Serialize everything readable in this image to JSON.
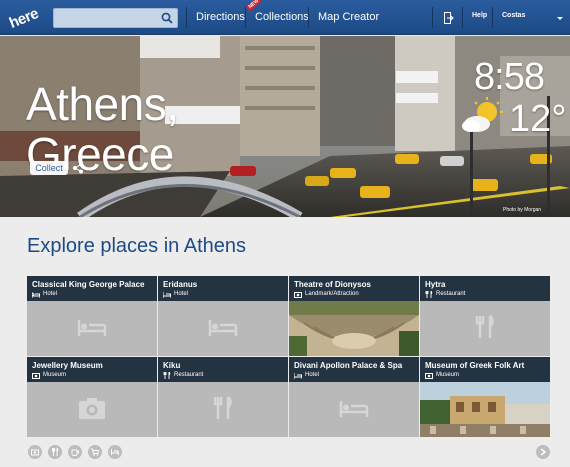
{
  "header": {
    "search_placeholder": "",
    "nav": [
      {
        "label": "Directions"
      },
      {
        "label": "Collections",
        "badge": "NEW"
      },
      {
        "label": "Map Creator"
      }
    ],
    "help_label": "Help",
    "user_label": "Costas"
  },
  "hero": {
    "section_label": "",
    "title_line1": "Athens,",
    "title_line2": "Greece",
    "collect_label": "Collect",
    "time": "8:58",
    "temperature": "12°",
    "credit": "Photo by Morgan"
  },
  "explore": {
    "title": "Explore places in Athens",
    "places": [
      {
        "name": "Classical King George Palace",
        "category": "Hotel",
        "icon": "bed-icon"
      },
      {
        "name": "Eridanus",
        "category": "Hotel",
        "icon": "bed-icon"
      },
      {
        "name": "Theatre of Dionysos",
        "category": "Landmark/Attraction",
        "icon": "camera-icon",
        "photo": "ancient-theatre"
      },
      {
        "name": "Hytra",
        "category": "Restaurant",
        "icon": "cutlery-icon"
      },
      {
        "name": "Jewellery Museum",
        "category": "Museum",
        "icon": "camera-icon"
      },
      {
        "name": "Kiku",
        "category": "Restaurant",
        "icon": "cutlery-icon"
      },
      {
        "name": "Divani Apollon Palace & Spa",
        "category": "Hotel",
        "icon": "bed-icon"
      },
      {
        "name": "Museum of Greek Folk Art",
        "category": "Museum",
        "icon": "camera-icon",
        "photo": "ruins-and-trees"
      }
    ]
  },
  "filters": [
    "camera-icon",
    "cutlery-icon",
    "coffee-icon",
    "cart-icon",
    "bed-icon"
  ],
  "colors": {
    "brand": "#1d4a86",
    "card_header": "#243342",
    "card_placeholder": "#b9b9b9"
  }
}
